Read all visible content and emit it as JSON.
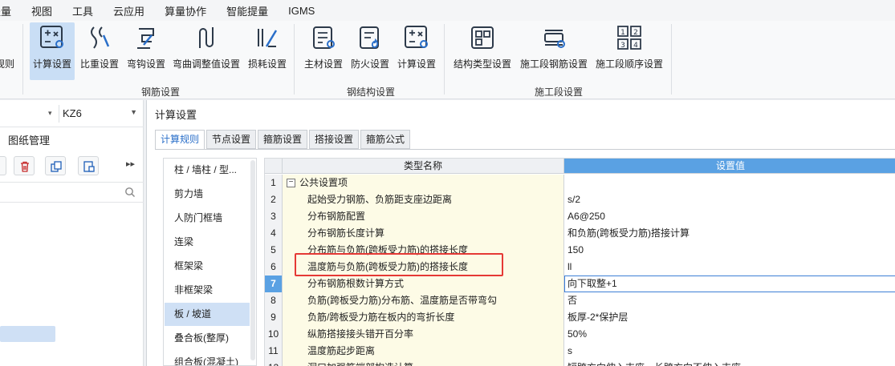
{
  "menu": [
    "提量",
    "视图",
    "工具",
    "云应用",
    "算量协作",
    "智能提量",
    "IGMS"
  ],
  "ribbon": {
    "partial_label": "规则",
    "rebar_group": {
      "label": "钢筋设置",
      "buttons": [
        {
          "label": "计算设置",
          "icon": "calc-settings-icon",
          "active": true
        },
        {
          "label": "比重设置",
          "icon": "rebar-weight-icon"
        },
        {
          "label": "弯钩设置",
          "icon": "hook-settings-icon"
        },
        {
          "label": "弯曲调整值设置",
          "icon": "bend-adjust-icon"
        },
        {
          "label": "损耗设置",
          "icon": "loss-settings-icon"
        }
      ]
    },
    "steel_group": {
      "label": "钢结构设置",
      "buttons": [
        {
          "label": "主材设置",
          "icon": "main-material-icon"
        },
        {
          "label": "防火设置",
          "icon": "fire-settings-icon"
        },
        {
          "label": "计算设置",
          "icon": "steel-calc-icon"
        }
      ]
    },
    "construction_group": {
      "label": "施工段设置",
      "buttons": [
        {
          "label": "结构类型设置",
          "icon": "structure-type-icon"
        },
        {
          "label": "施工段钢筋设置",
          "icon": "segment-rebar-icon"
        },
        {
          "label": "施工段顺序设置",
          "icon": "segment-order-icon"
        }
      ]
    }
  },
  "left_panel": {
    "component_value": "KZ6",
    "title": "图纸管理"
  },
  "dialog": {
    "title": "计算设置",
    "tabs": [
      "计算规则",
      "节点设置",
      "箍筋设置",
      "搭接设置",
      "箍筋公式"
    ],
    "active_tab": 0,
    "categories": [
      "柱 / 墙柱 / 型...",
      "剪力墙",
      "人防门框墙",
      "连梁",
      "框架梁",
      "非框架梁",
      "板 / 坡道",
      "叠合板(整厚)",
      "组合板(混凝土)"
    ],
    "selected_category": 6,
    "grid": {
      "headers": {
        "name": "类型名称",
        "value": "设置值"
      },
      "rows": [
        {
          "num": "1",
          "name": "公共设置项",
          "value": "",
          "group": true
        },
        {
          "num": "2",
          "name": "起始受力钢筋、负筋距支座边距离",
          "value": "s/2"
        },
        {
          "num": "3",
          "name": "分布钢筋配置",
          "value": "A6@250"
        },
        {
          "num": "4",
          "name": "分布钢筋长度计算",
          "value": "和负筋(跨板受力筋)搭接计算"
        },
        {
          "num": "5",
          "name": "分布筋与负筋(跨板受力筋)的搭接长度",
          "value": "150"
        },
        {
          "num": "6",
          "name": "温度筋与负筋(跨板受力筋)的搭接长度",
          "value": "ll",
          "highlighted": true
        },
        {
          "num": "7",
          "name": "分布钢筋根数计算方式",
          "value": "向下取整+1",
          "current": true
        },
        {
          "num": "8",
          "name": "负筋(跨板受力筋)分布筋、温度筋是否带弯勾",
          "value": "否"
        },
        {
          "num": "9",
          "name": "负筋/跨板受力筋在板内的弯折长度",
          "value": "板厚-2*保护层"
        },
        {
          "num": "10",
          "name": "纵筋搭接接头错开百分率",
          "value": "50%"
        },
        {
          "num": "11",
          "name": "温度筋起步距离",
          "value": "s"
        },
        {
          "num": "12",
          "name": "洞口加强筋端部构造计算",
          "value": "短跨方向伸入支座，长跨方向不伸入支座"
        }
      ]
    }
  },
  "colors": {
    "accent": "#5aa1e3",
    "highlight_box": "#e53935",
    "selection": "#cfe0f5",
    "name_cell_bg": "#fdfbe6"
  }
}
